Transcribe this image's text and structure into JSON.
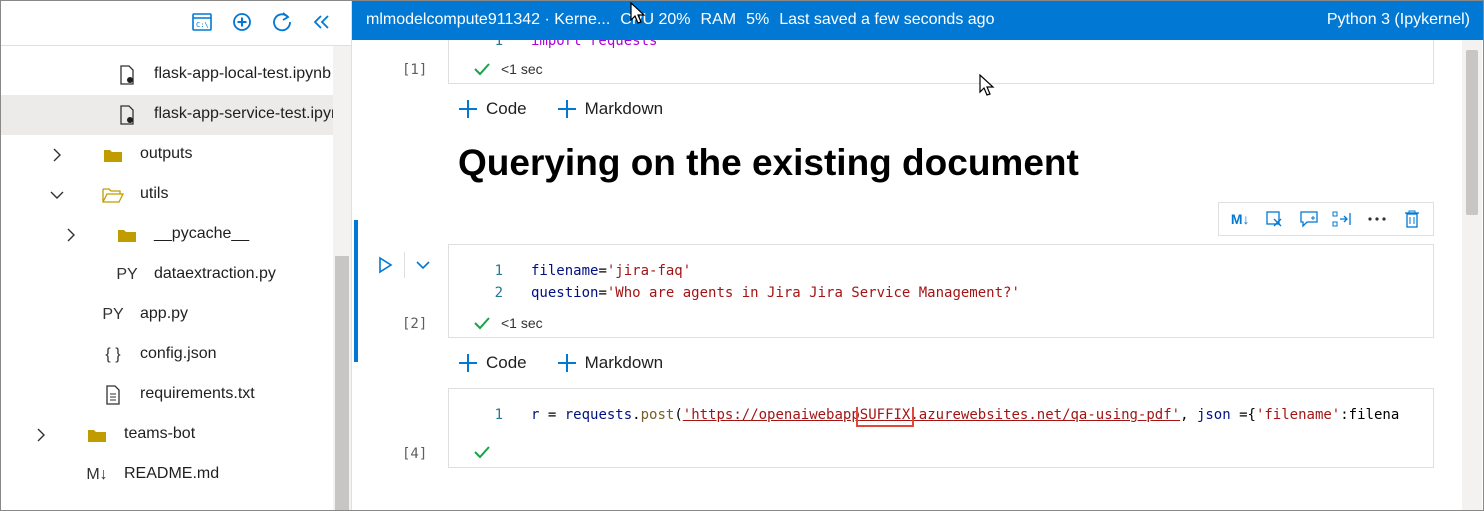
{
  "sidebar": {
    "toolbar": [
      {
        "name": "terminal-icon"
      },
      {
        "name": "add-icon"
      },
      {
        "name": "refresh-icon"
      },
      {
        "name": "collapse-icon"
      }
    ],
    "tree": [
      {
        "label": "flask-app-local-test.ipynb",
        "icon": "notebook-icon",
        "expand": null,
        "selected": false
      },
      {
        "label": "flask-app-service-test.ipynb",
        "icon": "notebook-icon",
        "expand": null,
        "selected": true
      },
      {
        "label": "outputs",
        "icon": "folder-icon",
        "expand": "collapsed",
        "selected": false
      },
      {
        "label": "utils",
        "icon": "folder-open-icon",
        "expand": "expanded",
        "selected": false
      },
      {
        "label": "__pycache__",
        "icon": "folder-icon",
        "expand": "collapsed",
        "selected": false
      },
      {
        "label": "dataextraction.py",
        "icon": "PY",
        "expand": null,
        "selected": false
      },
      {
        "label": "app.py",
        "icon": "PY",
        "expand": null,
        "selected": false
      },
      {
        "label": "config.json",
        "icon": "{ }",
        "expand": null,
        "selected": false
      },
      {
        "label": "requirements.txt",
        "icon": "file-text-icon",
        "expand": null,
        "selected": false
      },
      {
        "label": "teams-bot",
        "icon": "folder-icon",
        "expand": "collapsed",
        "selected": false
      },
      {
        "label": "README.md",
        "icon": "M↓",
        "expand": null,
        "selected": false
      }
    ]
  },
  "topbar": {
    "compute": "mlmodelcompute911342 · Kerne...",
    "cpu": "CPU 20%",
    "ram": "RAM",
    "ram_value": "5%",
    "saved": "Last saved a few seconds ago",
    "kernel": "Python 3 (Ipykernel)"
  },
  "notebook": {
    "cell1": {
      "count": "[1]",
      "lines": [
        {
          "n": "1",
          "text": "import requests"
        }
      ],
      "time": "<1 sec"
    },
    "add_code": "Code",
    "add_markdown": "Markdown",
    "heading": "Querying on the existing document",
    "cell2": {
      "count": "[2]",
      "line1_n": "1",
      "line1_var": "filename",
      "line1_op": "=",
      "line1_str": "'jira-faq'",
      "line2_n": "2",
      "line2_var": "question",
      "line2_op": "=",
      "line2_str": "'Who are agents in Jira Jira Service Management?'",
      "time": "<1 sec"
    },
    "cell3": {
      "count": "[4]",
      "n": "1",
      "r": "r",
      "eq": " = ",
      "obj": "requests",
      "dot": ".",
      "fn": "post",
      "paren": "(",
      "url_a": "'https://openaiwebapp",
      "url_suffix": "SUFFIX",
      "url_b": ".azurewebsites.net/qa-using-pdf'",
      "rest1": ", ",
      "json_kw": "json",
      "rest2": " ={",
      "key": "'filename'",
      "rest3": ":filena"
    },
    "cell_toolbar": [
      {
        "name": "markdown-toggle-icon",
        "glyph": "M↓"
      },
      {
        "name": "clear-output-icon",
        "glyph": "⊠"
      },
      {
        "name": "comment-icon",
        "glyph": "💬"
      },
      {
        "name": "split-cell-icon",
        "glyph": "⇥"
      },
      {
        "name": "more-icon",
        "glyph": "···"
      },
      {
        "name": "delete-icon",
        "glyph": "🗑"
      }
    ]
  },
  "colors": {
    "accent": "#0078d4",
    "success": "#16a34a",
    "highlight": "#e0493a"
  }
}
